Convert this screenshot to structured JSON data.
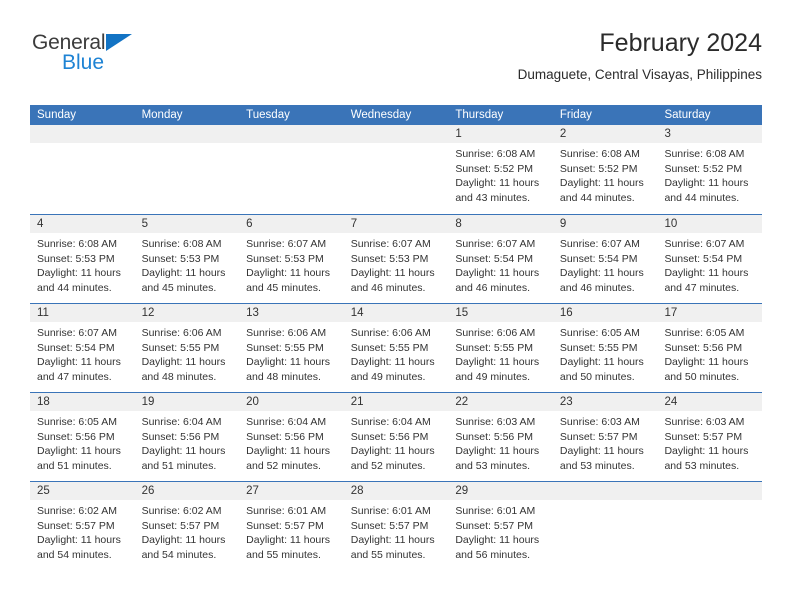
{
  "brand": {
    "name_part1": "General",
    "name_part2": "Blue",
    "triangle_color": "#1273c4",
    "blue_color": "#1e83d4"
  },
  "header": {
    "title": "February 2024",
    "subtitle": "Dumaguete, Central Visayas, Philippines"
  },
  "theme": {
    "header_bar": "#3a74b8",
    "daynum_band": "#f0f0f0",
    "separator": "#3a74b8",
    "text": "#333333"
  },
  "weekdays": [
    "Sunday",
    "Monday",
    "Tuesday",
    "Wednesday",
    "Thursday",
    "Friday",
    "Saturday"
  ],
  "labels": {
    "sunrise_prefix": "Sunrise: ",
    "sunset_prefix": "Sunset: ",
    "daylight_prefix": "Daylight: "
  },
  "weeks": [
    [
      {
        "day": "",
        "empty": true
      },
      {
        "day": "",
        "empty": true
      },
      {
        "day": "",
        "empty": true
      },
      {
        "day": "",
        "empty": true
      },
      {
        "day": "1",
        "sunrise": "Sunrise: 6:08 AM",
        "sunset": "Sunset: 5:52 PM",
        "daylight": "Daylight: 11 hours and 43 minutes."
      },
      {
        "day": "2",
        "sunrise": "Sunrise: 6:08 AM",
        "sunset": "Sunset: 5:52 PM",
        "daylight": "Daylight: 11 hours and 44 minutes."
      },
      {
        "day": "3",
        "sunrise": "Sunrise: 6:08 AM",
        "sunset": "Sunset: 5:52 PM",
        "daylight": "Daylight: 11 hours and 44 minutes."
      }
    ],
    [
      {
        "day": "4",
        "sunrise": "Sunrise: 6:08 AM",
        "sunset": "Sunset: 5:53 PM",
        "daylight": "Daylight: 11 hours and 44 minutes."
      },
      {
        "day": "5",
        "sunrise": "Sunrise: 6:08 AM",
        "sunset": "Sunset: 5:53 PM",
        "daylight": "Daylight: 11 hours and 45 minutes."
      },
      {
        "day": "6",
        "sunrise": "Sunrise: 6:07 AM",
        "sunset": "Sunset: 5:53 PM",
        "daylight": "Daylight: 11 hours and 45 minutes."
      },
      {
        "day": "7",
        "sunrise": "Sunrise: 6:07 AM",
        "sunset": "Sunset: 5:53 PM",
        "daylight": "Daylight: 11 hours and 46 minutes."
      },
      {
        "day": "8",
        "sunrise": "Sunrise: 6:07 AM",
        "sunset": "Sunset: 5:54 PM",
        "daylight": "Daylight: 11 hours and 46 minutes."
      },
      {
        "day": "9",
        "sunrise": "Sunrise: 6:07 AM",
        "sunset": "Sunset: 5:54 PM",
        "daylight": "Daylight: 11 hours and 46 minutes."
      },
      {
        "day": "10",
        "sunrise": "Sunrise: 6:07 AM",
        "sunset": "Sunset: 5:54 PM",
        "daylight": "Daylight: 11 hours and 47 minutes."
      }
    ],
    [
      {
        "day": "11",
        "sunrise": "Sunrise: 6:07 AM",
        "sunset": "Sunset: 5:54 PM",
        "daylight": "Daylight: 11 hours and 47 minutes."
      },
      {
        "day": "12",
        "sunrise": "Sunrise: 6:06 AM",
        "sunset": "Sunset: 5:55 PM",
        "daylight": "Daylight: 11 hours and 48 minutes."
      },
      {
        "day": "13",
        "sunrise": "Sunrise: 6:06 AM",
        "sunset": "Sunset: 5:55 PM",
        "daylight": "Daylight: 11 hours and 48 minutes."
      },
      {
        "day": "14",
        "sunrise": "Sunrise: 6:06 AM",
        "sunset": "Sunset: 5:55 PM",
        "daylight": "Daylight: 11 hours and 49 minutes."
      },
      {
        "day": "15",
        "sunrise": "Sunrise: 6:06 AM",
        "sunset": "Sunset: 5:55 PM",
        "daylight": "Daylight: 11 hours and 49 minutes."
      },
      {
        "day": "16",
        "sunrise": "Sunrise: 6:05 AM",
        "sunset": "Sunset: 5:55 PM",
        "daylight": "Daylight: 11 hours and 50 minutes."
      },
      {
        "day": "17",
        "sunrise": "Sunrise: 6:05 AM",
        "sunset": "Sunset: 5:56 PM",
        "daylight": "Daylight: 11 hours and 50 minutes."
      }
    ],
    [
      {
        "day": "18",
        "sunrise": "Sunrise: 6:05 AM",
        "sunset": "Sunset: 5:56 PM",
        "daylight": "Daylight: 11 hours and 51 minutes."
      },
      {
        "day": "19",
        "sunrise": "Sunrise: 6:04 AM",
        "sunset": "Sunset: 5:56 PM",
        "daylight": "Daylight: 11 hours and 51 minutes."
      },
      {
        "day": "20",
        "sunrise": "Sunrise: 6:04 AM",
        "sunset": "Sunset: 5:56 PM",
        "daylight": "Daylight: 11 hours and 52 minutes."
      },
      {
        "day": "21",
        "sunrise": "Sunrise: 6:04 AM",
        "sunset": "Sunset: 5:56 PM",
        "daylight": "Daylight: 11 hours and 52 minutes."
      },
      {
        "day": "22",
        "sunrise": "Sunrise: 6:03 AM",
        "sunset": "Sunset: 5:56 PM",
        "daylight": "Daylight: 11 hours and 53 minutes."
      },
      {
        "day": "23",
        "sunrise": "Sunrise: 6:03 AM",
        "sunset": "Sunset: 5:57 PM",
        "daylight": "Daylight: 11 hours and 53 minutes."
      },
      {
        "day": "24",
        "sunrise": "Sunrise: 6:03 AM",
        "sunset": "Sunset: 5:57 PM",
        "daylight": "Daylight: 11 hours and 53 minutes."
      }
    ],
    [
      {
        "day": "25",
        "sunrise": "Sunrise: 6:02 AM",
        "sunset": "Sunset: 5:57 PM",
        "daylight": "Daylight: 11 hours and 54 minutes."
      },
      {
        "day": "26",
        "sunrise": "Sunrise: 6:02 AM",
        "sunset": "Sunset: 5:57 PM",
        "daylight": "Daylight: 11 hours and 54 minutes."
      },
      {
        "day": "27",
        "sunrise": "Sunrise: 6:01 AM",
        "sunset": "Sunset: 5:57 PM",
        "daylight": "Daylight: 11 hours and 55 minutes."
      },
      {
        "day": "28",
        "sunrise": "Sunrise: 6:01 AM",
        "sunset": "Sunset: 5:57 PM",
        "daylight": "Daylight: 11 hours and 55 minutes."
      },
      {
        "day": "29",
        "sunrise": "Sunrise: 6:01 AM",
        "sunset": "Sunset: 5:57 PM",
        "daylight": "Daylight: 11 hours and 56 minutes."
      },
      {
        "day": "",
        "empty": true
      },
      {
        "day": "",
        "empty": true
      }
    ]
  ]
}
